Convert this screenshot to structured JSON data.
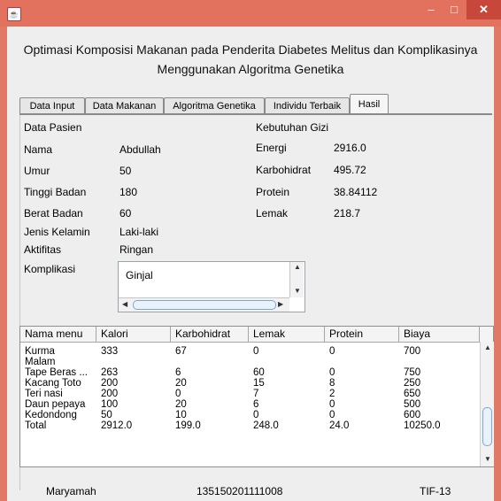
{
  "app": {
    "title_line1": "Optimasi Komposisi Makanan pada Penderita Diabetes Melitus dan Komplikasinya",
    "title_line2": "Menggunakan Algoritma Genetika",
    "window_controls": {
      "minimize": "–",
      "maximize": "□",
      "close": "✕"
    },
    "icon": "java-app-icon"
  },
  "tabs": [
    {
      "label": "Data Input"
    },
    {
      "label": "Data Makanan"
    },
    {
      "label": "Algoritma Genetika"
    },
    {
      "label": "Individu Terbaik"
    },
    {
      "label": "Hasil",
      "active": true
    }
  ],
  "patient": {
    "section": "Data Pasien",
    "fields": [
      {
        "label": "Nama",
        "value": "Abdullah"
      },
      {
        "label": "Umur",
        "value": "50"
      },
      {
        "label": "Tinggi Badan",
        "value": "180"
      },
      {
        "label": "Berat Badan",
        "value": "60"
      },
      {
        "label": "Jenis Kelamin",
        "value": "Laki-laki"
      },
      {
        "label": "Aktifitas",
        "value": "Ringan"
      }
    ],
    "komplikasi_label": "Komplikasi",
    "komplikasi_value": "Ginjal"
  },
  "nutrition": {
    "section": "Kebutuhan Gizi",
    "fields": [
      {
        "label": "Energi",
        "value": "2916.0"
      },
      {
        "label": "Karbohidrat",
        "value": "495.72"
      },
      {
        "label": "Protein",
        "value": "38.84112"
      },
      {
        "label": "Lemak",
        "value": "218.7"
      }
    ]
  },
  "table": {
    "headers": [
      "Nama menu",
      "Kalori",
      "Karbohidrat",
      "Lemak",
      "Protein",
      "Biaya"
    ],
    "partial_row": [
      "…",
      "…",
      "…",
      "…",
      "…",
      "…"
    ],
    "rows": [
      [
        "Kurma",
        "333",
        "67",
        "0",
        "0",
        "700"
      ],
      [
        "Malam",
        "",
        "",
        "",
        "",
        ""
      ],
      [
        "Tape Beras ...",
        "263",
        "6",
        "60",
        "0",
        "750"
      ],
      [
        "Kacang Toto",
        "200",
        "20",
        "15",
        "8",
        "250"
      ],
      [
        "Teri nasi",
        "200",
        "0",
        "7",
        "2",
        "650"
      ],
      [
        "Daun pepaya",
        "100",
        "20",
        "6",
        "0",
        "500"
      ],
      [
        "Kedondong",
        "50",
        "10",
        "0",
        "0",
        "600"
      ],
      [
        "Total",
        "2912.0",
        "199.0",
        "248.0",
        "24.0",
        "10250.0"
      ]
    ]
  },
  "footer": {
    "name": "Maryamah",
    "nim": "135150201111008",
    "class": "TIF-13"
  }
}
